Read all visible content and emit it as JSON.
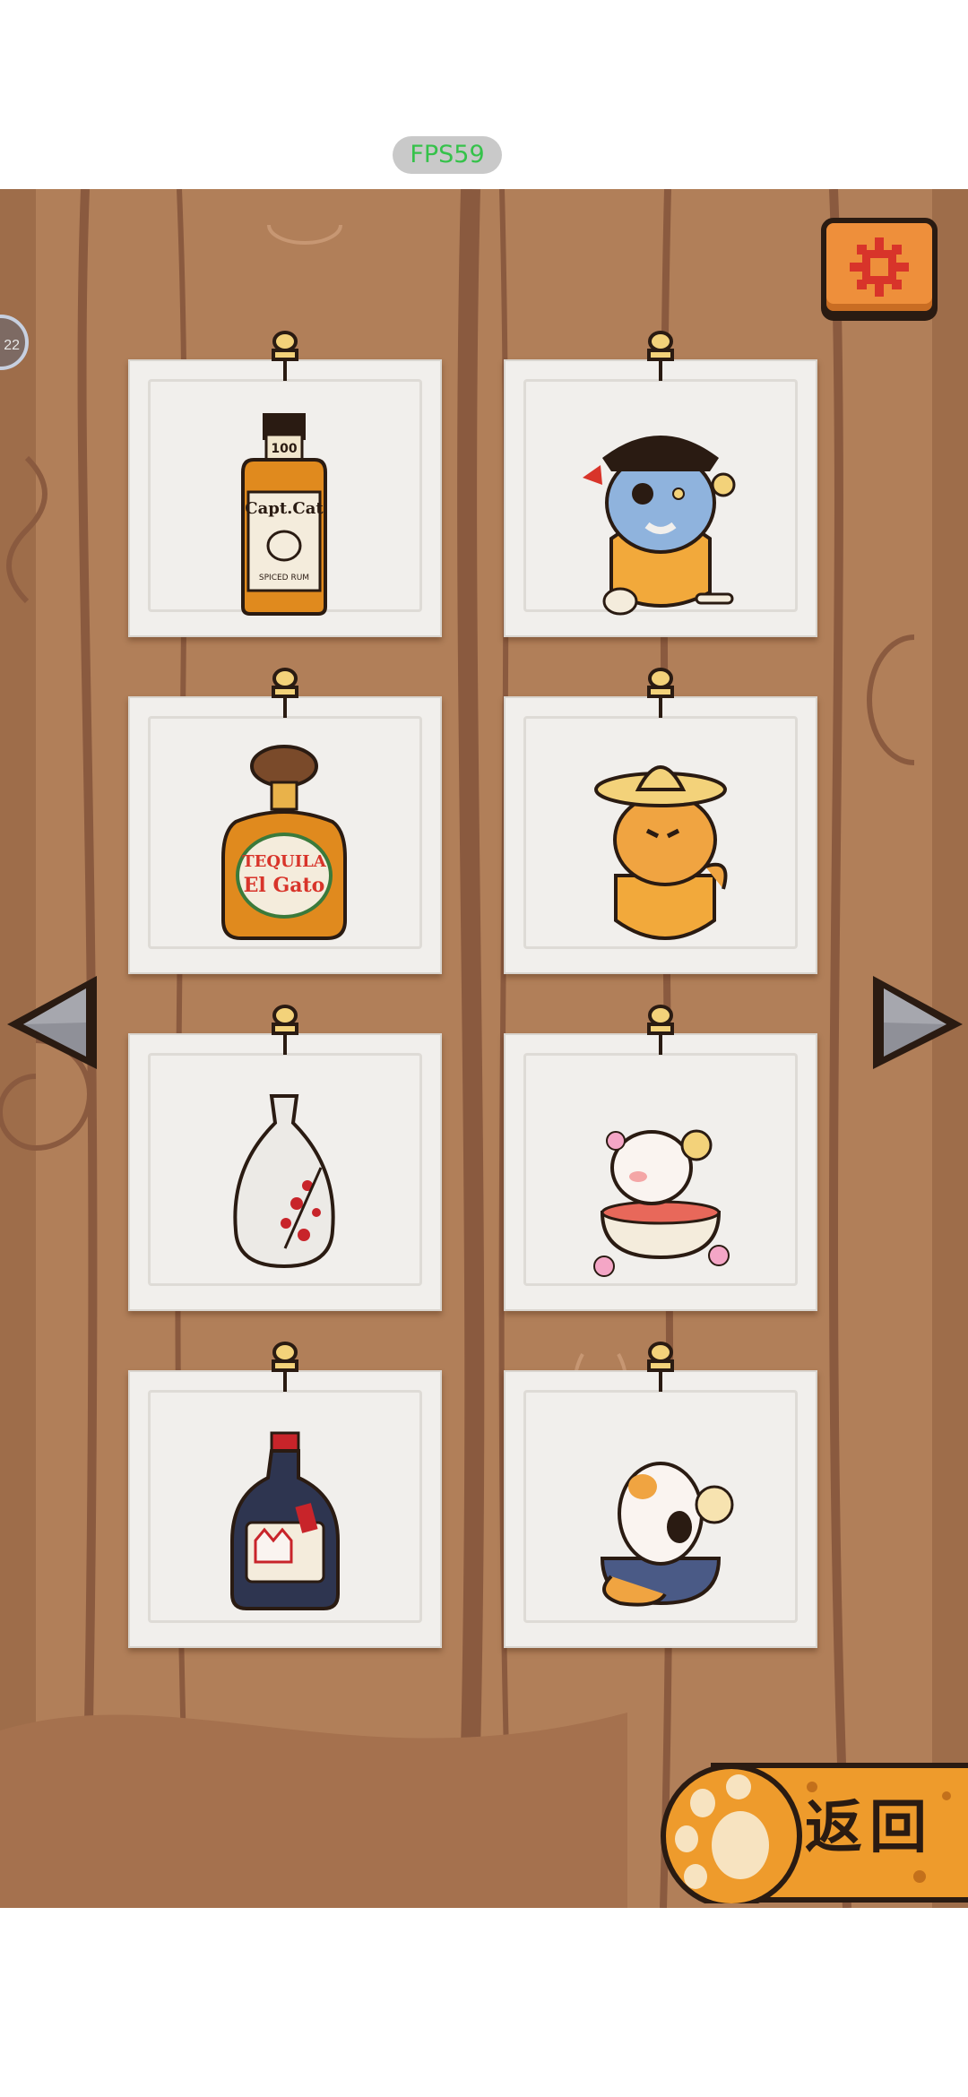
{
  "hud": {
    "fps": "FPS59",
    "side_badge": "22"
  },
  "board": {
    "colors": {
      "wood": "#b17f59",
      "grain_dark": "#8a5a3f",
      "grain_light": "#c79773",
      "accent": "#ee8f3b"
    },
    "cards": [
      {
        "item": "captain-cat-rum-bottle",
        "caption": "Capt.Cat",
        "subcaption": "SPICED RUM",
        "tag": "100"
      },
      {
        "item": "pirate-cat-in-glass"
      },
      {
        "item": "tequila-el-gato-bottle",
        "caption": "TEQUILA",
        "subcaption": "El Gato"
      },
      {
        "item": "sombrero-cat-in-glass"
      },
      {
        "item": "plum-blossom-sake-bottle"
      },
      {
        "item": "blossom-cat-in-sake-cup"
      },
      {
        "item": "kitsune-mask-sake-bottle"
      },
      {
        "item": "calico-cat-in-bowl"
      }
    ]
  },
  "nav": {
    "prev_icon": "left-triangle-icon",
    "next_icon": "right-triangle-icon",
    "settings_icon": "gear-icon"
  },
  "back_button": {
    "label": "返回",
    "icon": "cat-paw-icon"
  }
}
